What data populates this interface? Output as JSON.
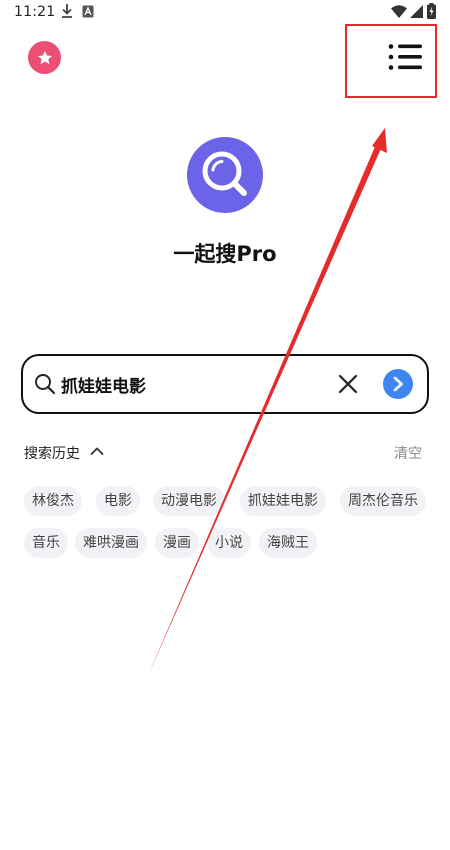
{
  "status_bar": {
    "time": "11:21",
    "icons": [
      "download-icon",
      "a-badge-icon",
      "wifi-icon",
      "signal-icon",
      "battery-charging-icon"
    ]
  },
  "header": {
    "favorites_icon": "star-icon",
    "menu_icon": "list-menu-icon"
  },
  "app": {
    "logo_icon": "magnifier-logo-icon",
    "title": "一起搜Pro"
  },
  "search": {
    "value": "抓娃娃电影",
    "placeholder": "",
    "clear_icon": "close-icon",
    "submit_icon": "chevron-right-icon"
  },
  "history": {
    "title": "搜索历史",
    "toggle_icon": "chevron-up-icon",
    "clear_label": "清空",
    "items": [
      "林俊杰",
      "电影",
      "动漫电影",
      "抓娃娃电影",
      "周杰伦音乐",
      "音乐",
      "难哄漫画",
      "漫画",
      "小说",
      "海贼王"
    ]
  },
  "colors": {
    "favorite": "#ec4f73",
    "logo": "#6b63e8",
    "submit": "#3f86f2",
    "annotation": "#e52b2b",
    "chip_bg": "#f1f2f5"
  }
}
